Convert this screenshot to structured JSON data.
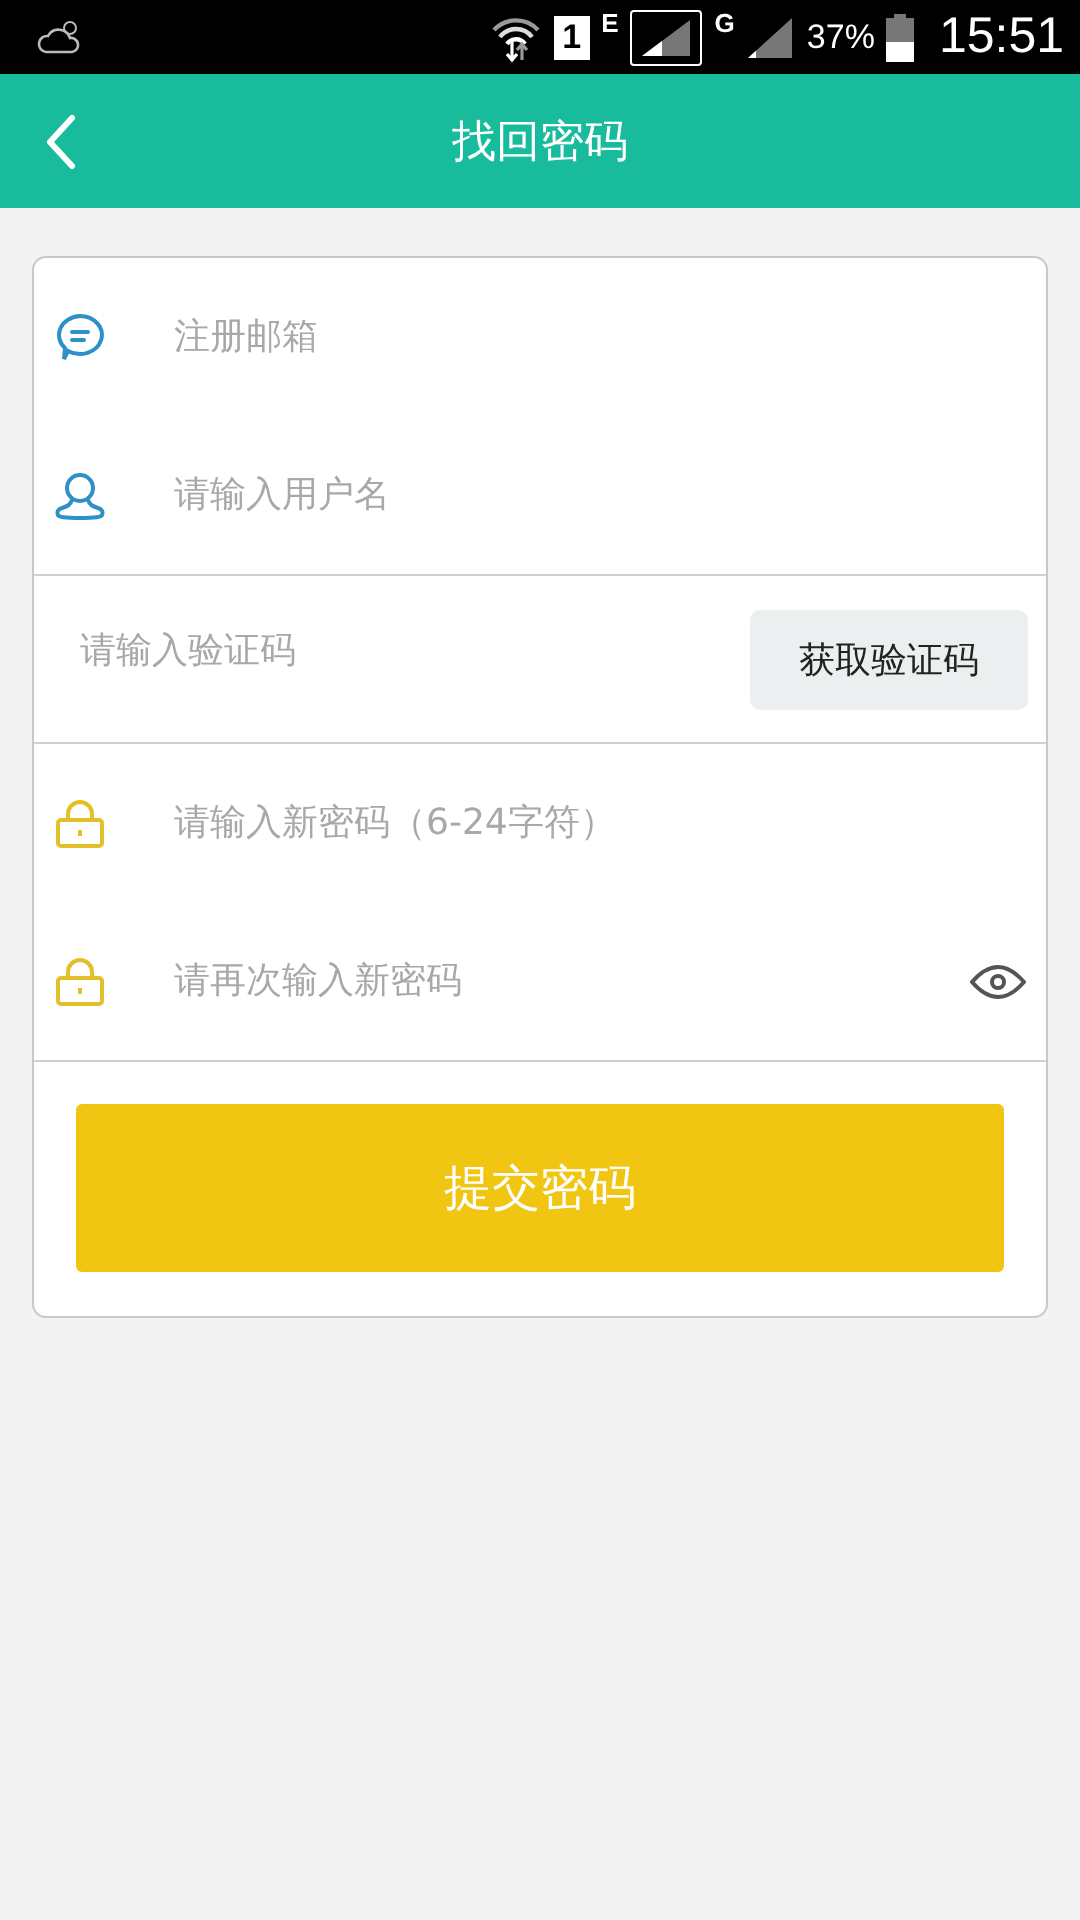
{
  "status_bar": {
    "sim": "1",
    "network_1": "E",
    "network_2": "G",
    "battery": "37%",
    "time": "15:51"
  },
  "header": {
    "title": "找回密码"
  },
  "account_fields": [
    {
      "kind": "email",
      "placeholder": "注册邮箱"
    },
    {
      "kind": "user",
      "placeholder": "请输入用户名"
    }
  ],
  "code_field": {
    "placeholder": "请输入验证码",
    "button": "获取验证码"
  },
  "password_fields": [
    {
      "placeholder": "请输入新密码（6-24字符）",
      "show_toggle": false
    },
    {
      "placeholder": "请再次输入新密码",
      "show_toggle": true
    }
  ],
  "submit_button": "提交密码"
}
